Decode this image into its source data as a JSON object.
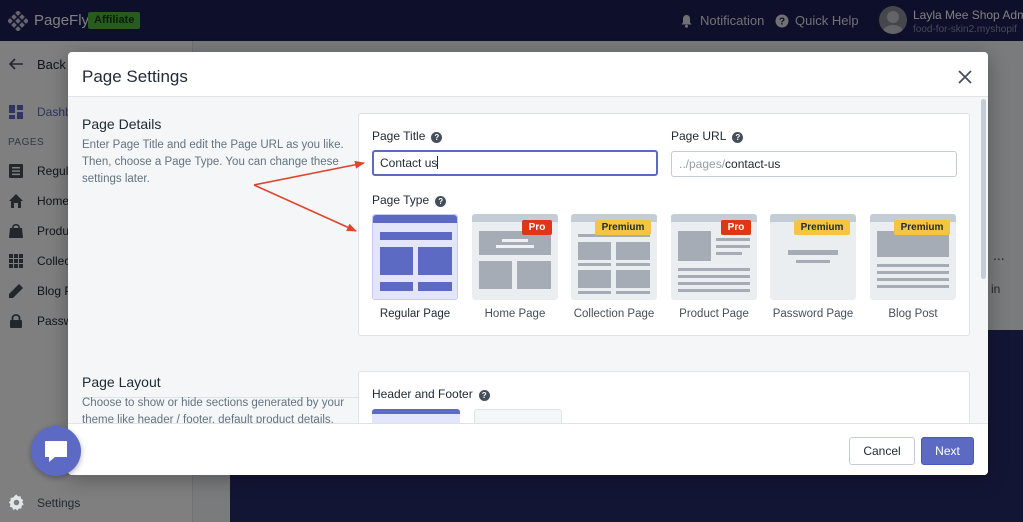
{
  "topbar": {
    "brand": "PageFly",
    "affiliate_badge": "Affiliate",
    "notification": "Notification",
    "quick_help": "Quick Help",
    "user_name": "Layla Mee Shop Adm",
    "user_shop": "food-for-skin2.myshopif"
  },
  "sidebar": {
    "back": "Back",
    "dashboard": "Dashb",
    "pages_heading": "PAGES",
    "items": [
      {
        "label": "Regul",
        "icon": "document-list-icon"
      },
      {
        "label": "Home",
        "icon": "home-icon"
      },
      {
        "label": "Produ",
        "icon": "shopping-bag-icon"
      },
      {
        "label": "Collec",
        "icon": "grid-icon"
      },
      {
        "label": "Blog P",
        "icon": "pencil-icon"
      },
      {
        "label": "Passw",
        "icon": "lock-icon"
      }
    ],
    "settings": "Settings"
  },
  "background": {
    "dots": "...",
    "partial_text": "in"
  },
  "modal": {
    "title": "Page Settings",
    "page_details": {
      "title": "Page Details",
      "description": "Enter Page Title and edit the Page URL as you like. Then, choose a Page Type. You can change these settings later.",
      "page_title_label": "Page Title",
      "page_title_value": "Contact us",
      "page_url_label": "Page URL",
      "page_url_prefix": "../pages/",
      "page_url_value": "contact-us",
      "page_type_label": "Page Type",
      "page_types": [
        {
          "label": "Regular Page",
          "badge": "",
          "selected": true
        },
        {
          "label": "Home Page",
          "badge": "Pro",
          "selected": false
        },
        {
          "label": "Collection Page",
          "badge": "Premium",
          "selected": false
        },
        {
          "label": "Product Page",
          "badge": "Pro",
          "selected": false
        },
        {
          "label": "Password Page",
          "badge": "Premium",
          "selected": false
        },
        {
          "label": "Blog Post",
          "badge": "Premium",
          "selected": false
        }
      ]
    },
    "page_layout": {
      "title": "Page Layout",
      "description": "Choose to show or hide sections generated by your theme like header / footer, default product details.",
      "header_footer_label": "Header and Footer"
    },
    "footer": {
      "cancel": "Cancel",
      "next": "Next"
    }
  },
  "colors": {
    "topbar": "#1c1f54",
    "accent": "#5c6ac4",
    "pro_badge": "#de3618",
    "premium_badge": "#f4c542",
    "annotation_arrow": "#e0452b"
  }
}
